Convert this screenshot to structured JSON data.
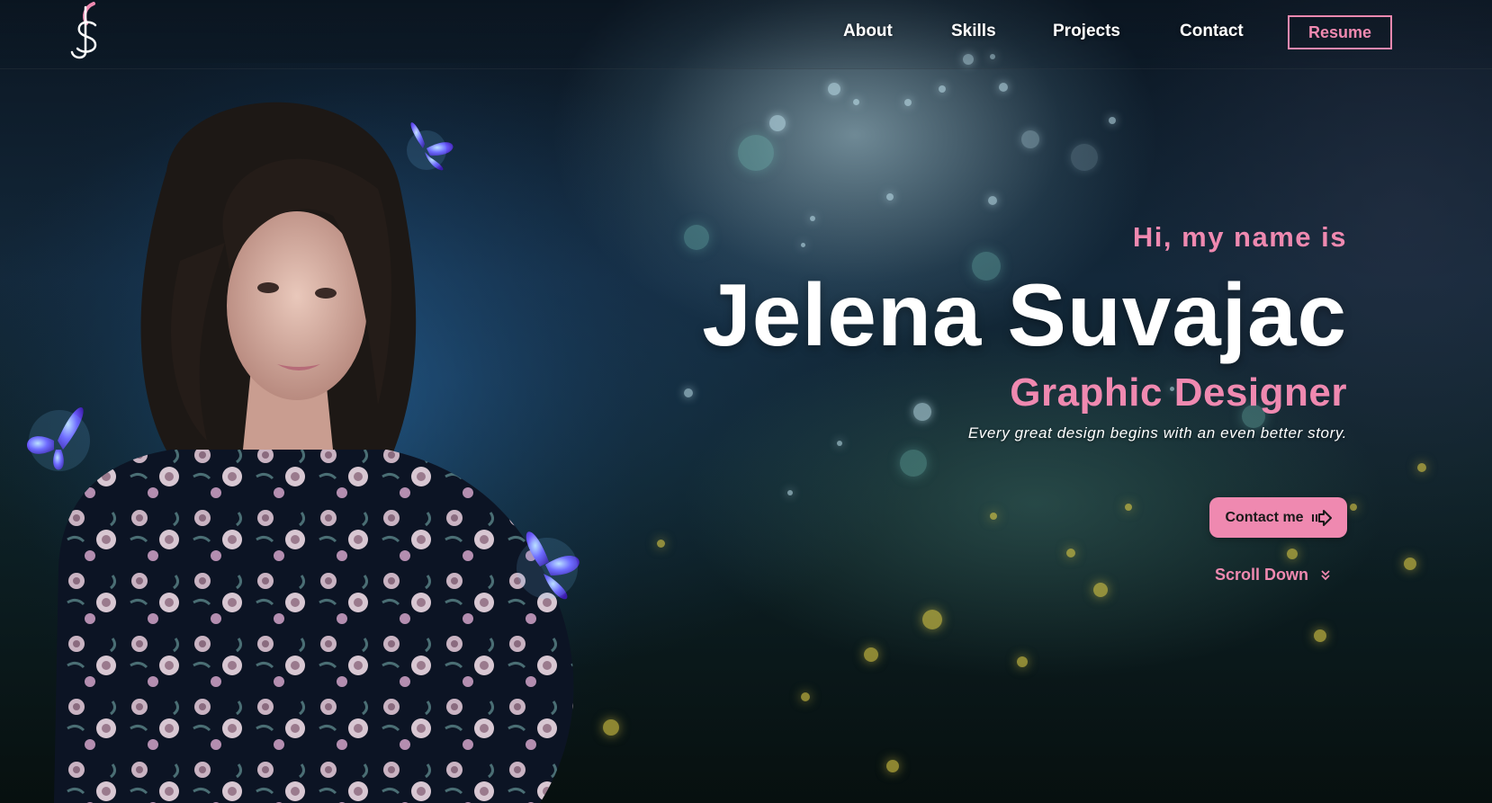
{
  "nav": {
    "items": [
      {
        "label": "About"
      },
      {
        "label": "Skills"
      },
      {
        "label": "Projects"
      },
      {
        "label": "Contact"
      }
    ],
    "resume_label": "Resume"
  },
  "hero": {
    "greeting": "Hi, my name is",
    "name": "Jelena Suvajac",
    "role": "Graphic Designer",
    "tagline": "Every great design begins with an even better story.",
    "contact_label": "Contact me",
    "scroll_label": "Scroll Down"
  },
  "icons": {
    "logo": "js-monogram-logo",
    "contact": "arrow-right-icon",
    "scroll": "chevron-down-icon"
  },
  "colors": {
    "accent": "#ef89b0",
    "text": "#ffffff"
  }
}
